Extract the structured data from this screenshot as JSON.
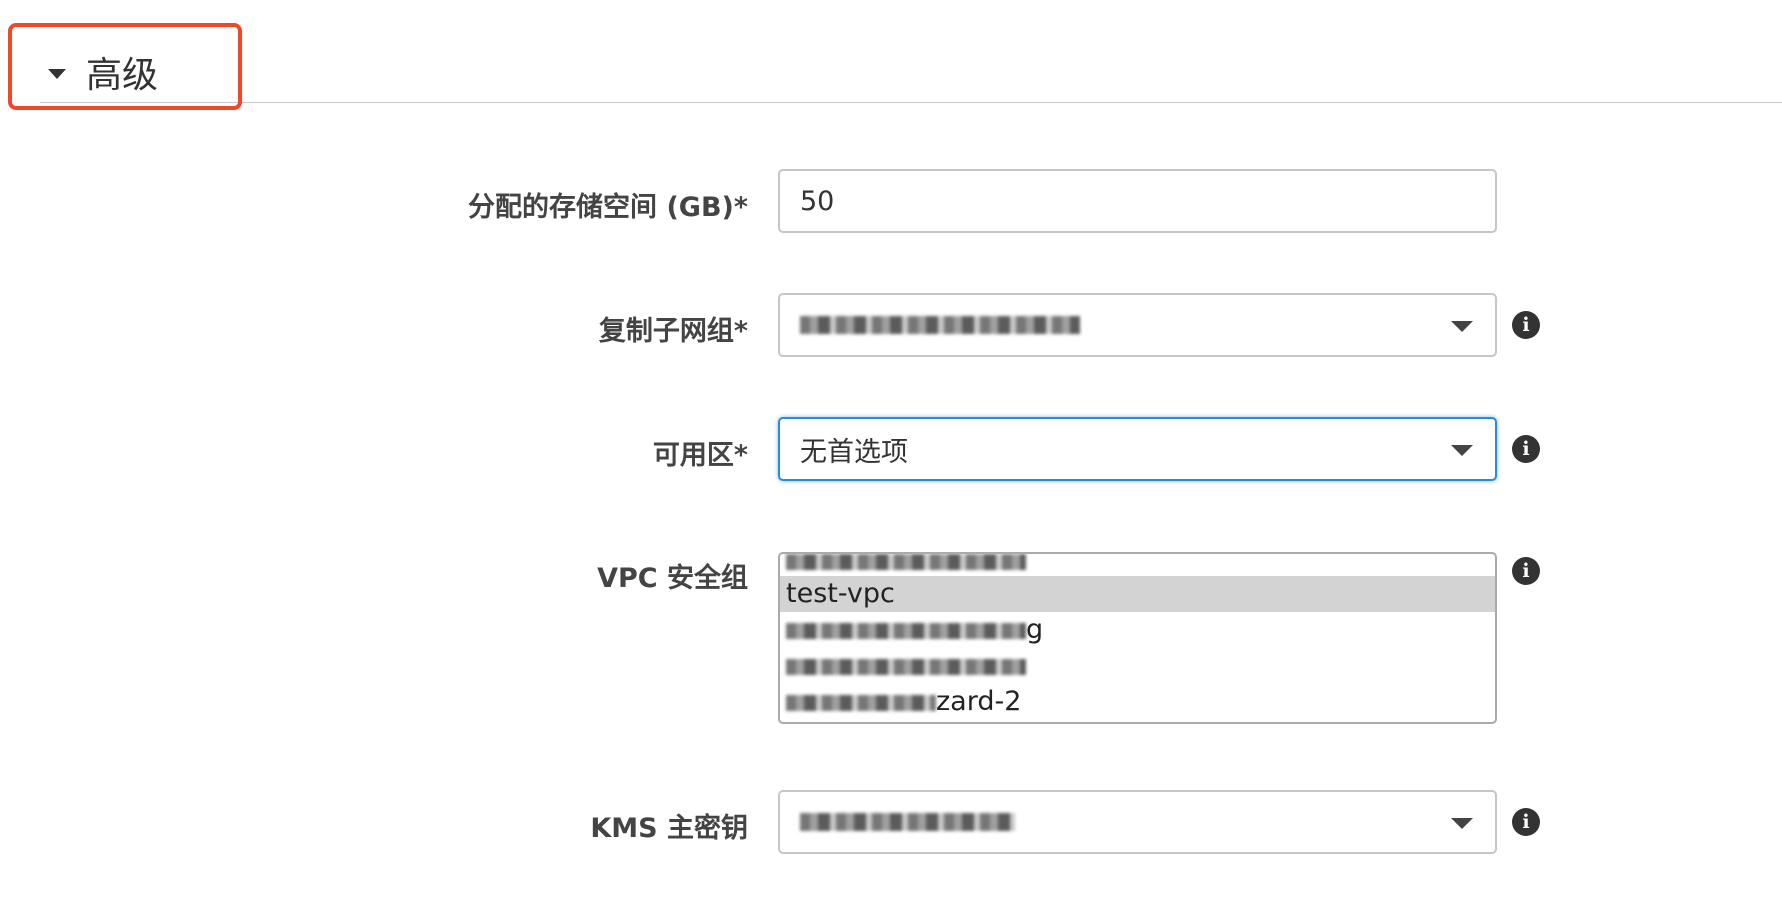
{
  "section": {
    "title": "高级"
  },
  "fields": {
    "storage": {
      "label": "分配的存储空间 (GB)*",
      "value": "50"
    },
    "subnet_group": {
      "label": "复制子网组*",
      "value": ""
    },
    "availability_zone": {
      "label": "可用区*",
      "value": "无首选项"
    },
    "vpc_security_group": {
      "label": "VPC 安全组",
      "options": [
        "",
        "test-vpc",
        "g",
        "",
        "zard-2"
      ]
    },
    "kms_key": {
      "label": "KMS 主密钥",
      "value": ""
    }
  },
  "icons": {
    "info": "i"
  },
  "colors": {
    "highlight": "#f0472a",
    "focus": "#2a8ae0",
    "selected_option": "#d3d3d3"
  }
}
